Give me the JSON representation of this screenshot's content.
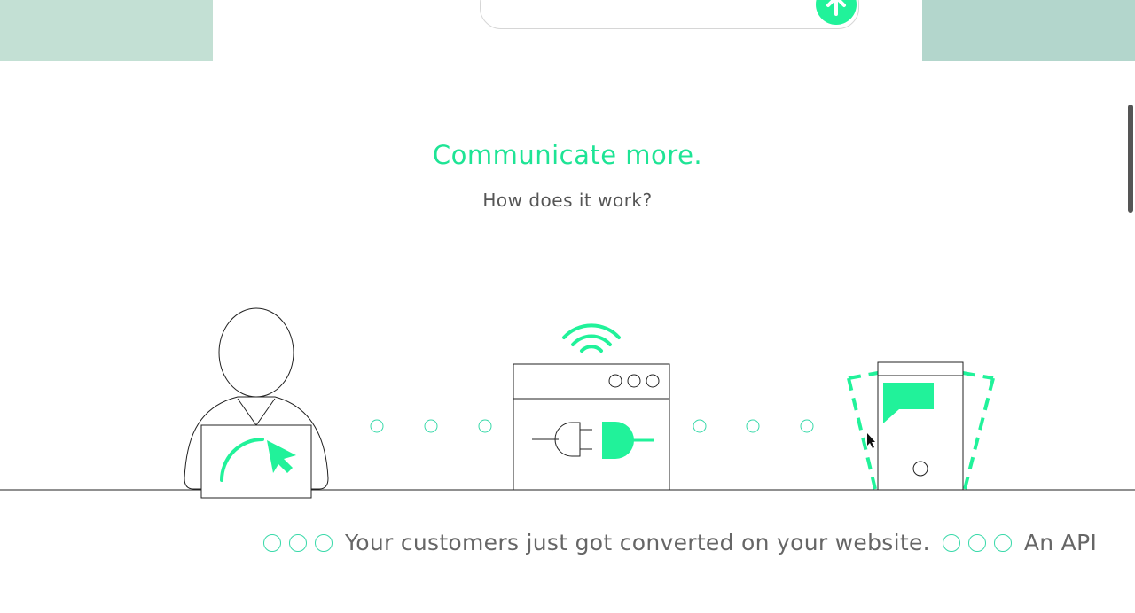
{
  "hero": {
    "title": "Communicate more.",
    "subtitle": "How does it work?"
  },
  "ticker": {
    "items": [
      "Your customers just got converted on your website.",
      "An API"
    ]
  },
  "colors": {
    "accent": "#21f29a",
    "band_left": "#c3e0d4",
    "band_right": "#b3d6cc",
    "text_muted": "#666666"
  },
  "icons": [
    "arrow-up-icon",
    "person-laptop-icon",
    "wifi-icon",
    "plug-icon",
    "phone-chat-icon"
  ]
}
